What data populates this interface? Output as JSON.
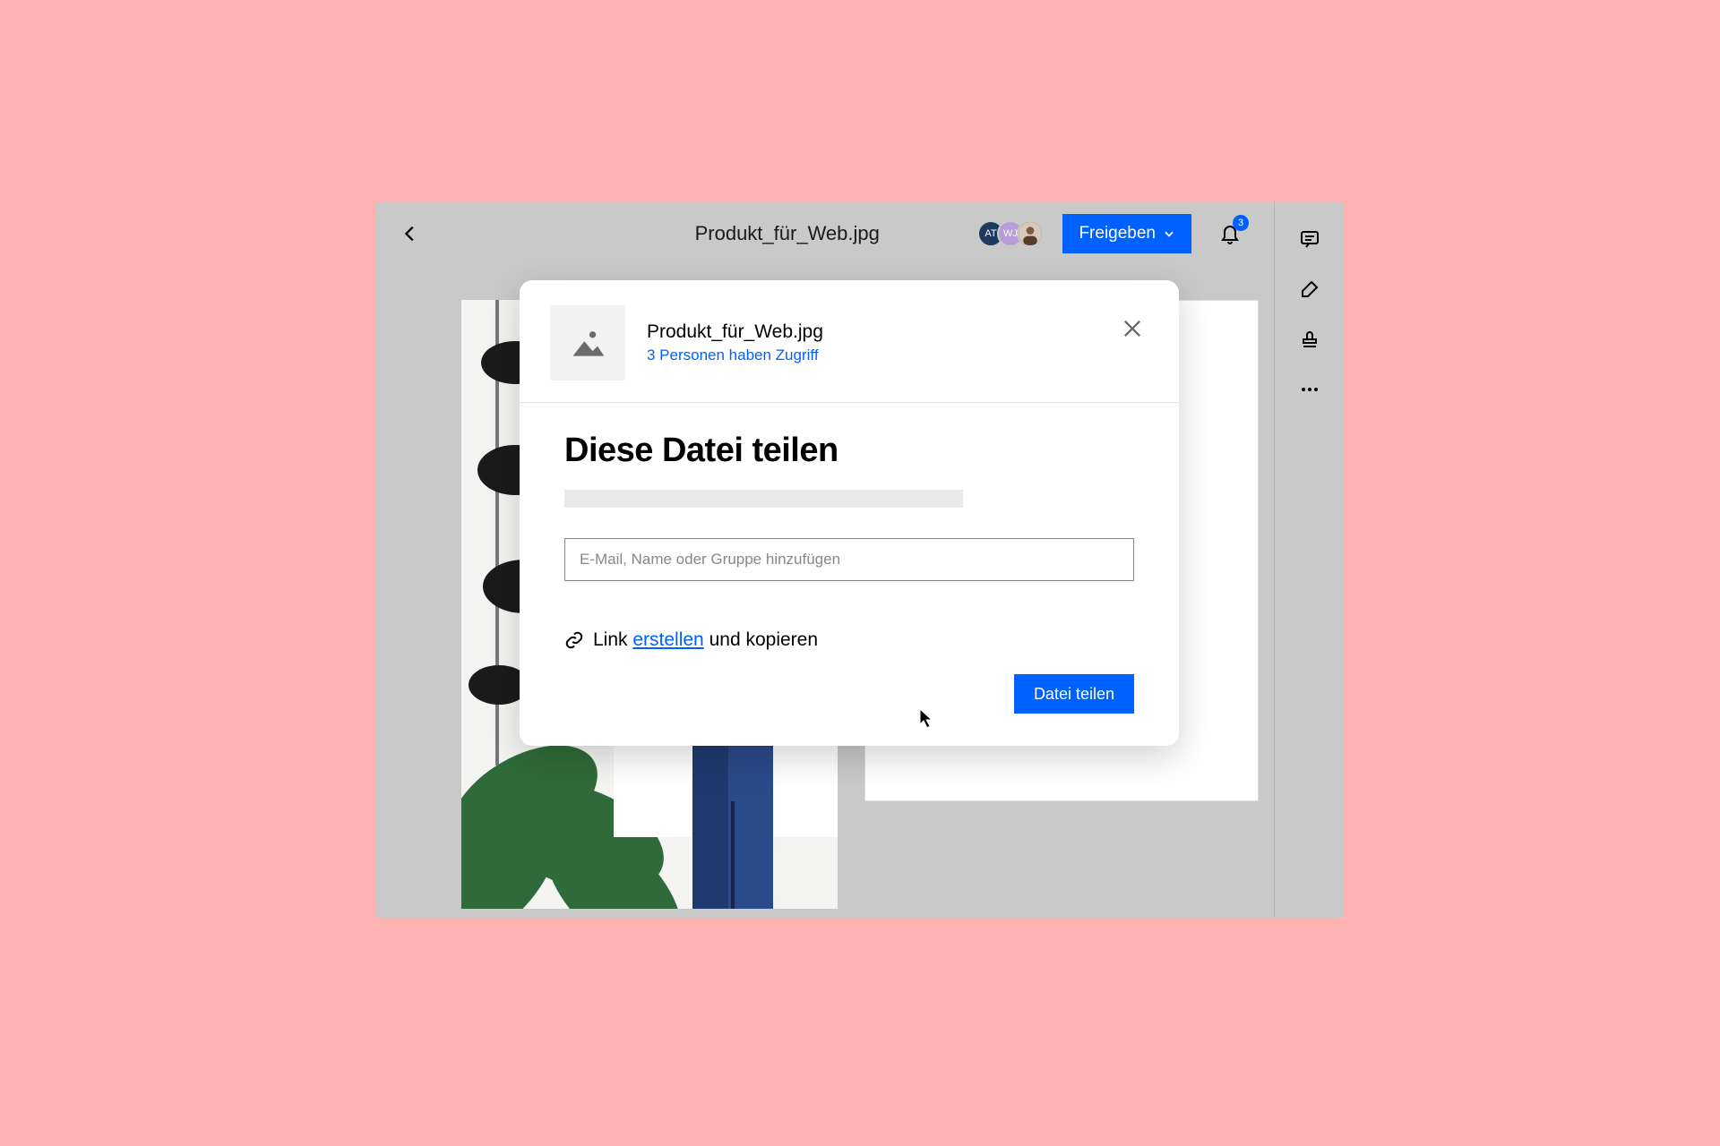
{
  "topbar": {
    "filename": "Produkt_für_Web.jpg",
    "share_label": "Freigeben",
    "avatars": [
      "AT",
      "WJ"
    ],
    "notification_count": "3"
  },
  "modal": {
    "filename": "Produkt_für_Web.jpg",
    "access_text": "3 Personen haben Zugriff",
    "title": "Diese Datei teilen",
    "email_placeholder": "E-Mail, Name oder Gruppe hinzufügen",
    "link_prefix": "Link ",
    "link_action": "erstellen",
    "link_suffix": " und kopieren",
    "submit_label": "Datei teilen"
  }
}
